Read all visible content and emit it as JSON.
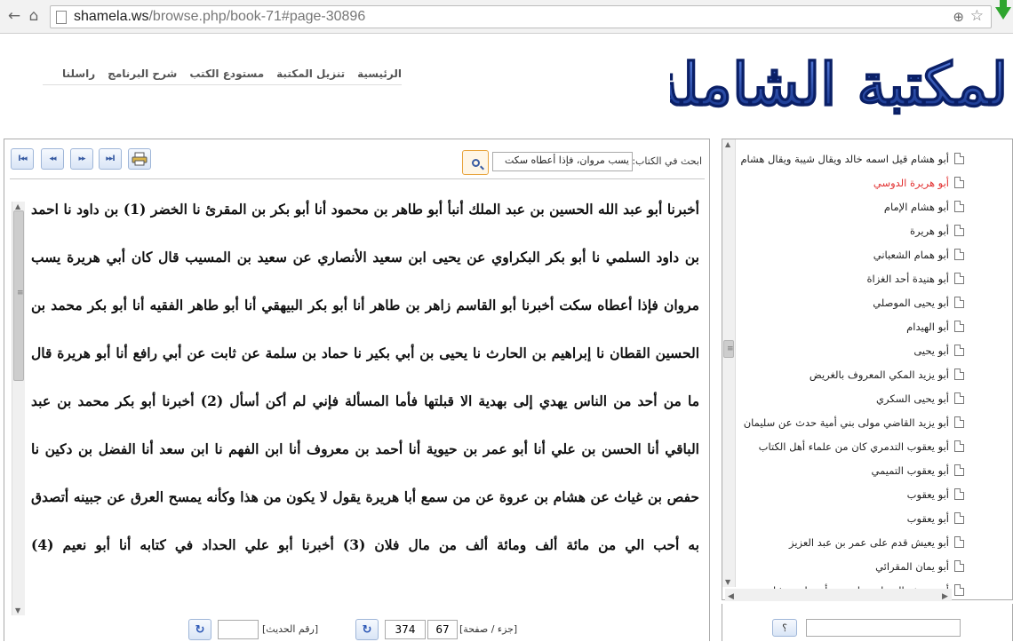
{
  "browser": {
    "url_domain": "shamela.ws",
    "url_path": "/browse.php/book-71#page-30896",
    "back_glyph": "←",
    "home_glyph": "⌂",
    "zoom_glyph": "⊕",
    "star_glyph": "☆",
    "icons": [
      "back-arrow-icon",
      "home-icon",
      "page-icon",
      "zoom-icon",
      "star-icon",
      "download-icon"
    ]
  },
  "nav": {
    "items": [
      "الرئيسية",
      "تنزيل المكتبة",
      "مستودع الكتب",
      "شرح البرنامج",
      "راسلنا"
    ]
  },
  "logo": {
    "text": "المكتبة الشاملة",
    "color": "#1d3f9e"
  },
  "toolbar": {
    "first_glyph": "I◂◂",
    "prev_glyph": "◂◂",
    "next_glyph": "▸▸",
    "last_glyph": "▸▸I",
    "print_icon": "print-icon",
    "search_label": "ابحث في الكتاب:",
    "search_value": "يسب مروان، فإذا أعطاه سكت",
    "search_icon": "search-icon"
  },
  "book": {
    "text": "أخبرنا أبو عبد الله الحسين بن عبد الملك أنبأ أبو طاهر بن محمود أنا أبو بكر بن المقرئ نا الخضر (1) بن داود نا احمد بن داود السلمي نا أبو بكر البكراوي عن يحيى ابن سعيد الأنصاري عن سعيد بن المسيب قال كان أبي هريرة يسب مروان فإذا أعطاه سكت أخبرنا أبو القاسم زاهر بن طاهر أنا أبو بكر البيهقي أنا أبو طاهر الفقيه أنا أبو بكر محمد بن الحسين القطان نا إبراهيم بن الحارث نا يحيى بن أبي بكير نا حماد بن سلمة عن ثابت عن أبي رافع أنا أبو هريرة قال ما من أحد من الناس يهدي إلى بهدية الا قبلتها فأما المسألة فإني لم أكن أسأل (2) أخبرنا أبو بكر محمد بن عبد الباقي أنا الحسن بن علي أنا أبو عمر بن حيوية أنا أحمد بن معروف أنا ابن الفهم نا ابن سعد أنا الفضل بن دكين نا حفص بن غياث عن هشام بن عروة عن من سمع أبا هريرة يقول لا يكون من هذا وكأنه يمسح العرق عن جبينه أتصدق به أحب الي من مائة ألف ومائة ألف من مال فلان (3) أخبرنا أبو علي الحداد في كتابه أنا أبو نعيم (4)"
  },
  "bottom": {
    "page_label": "[جزء / صفحة]",
    "part": "67",
    "page": "374",
    "hadith_label": "[رقم الحديث]",
    "hadith_value": "",
    "go_glyph": "↻",
    "go_icon": "refresh-icon"
  },
  "tree": {
    "items": [
      {
        "label": "أبو هشام قيل اسمه خالد ويقال شيبة ويقال هشام",
        "active": false
      },
      {
        "label": "أبو هريرة الدوسي",
        "active": true
      },
      {
        "label": "أبو هشام الإمام",
        "active": false
      },
      {
        "label": "أبو هريرة",
        "active": false
      },
      {
        "label": "أبو همام الشعباني",
        "active": false
      },
      {
        "label": "أبو هنيدة أحد الغزاة",
        "active": false
      },
      {
        "label": "أبو يحيى الموصلي",
        "active": false
      },
      {
        "label": "أبو الهيدام",
        "active": false
      },
      {
        "label": "أبو يحيى",
        "active": false
      },
      {
        "label": "أبو يزيد المكي المعروف بالغريض",
        "active": false
      },
      {
        "label": "أبو يحيى السكري",
        "active": false
      },
      {
        "label": "أبو يزيد القاضي مولى بني أمية حدث عن سليمان",
        "active": false
      },
      {
        "label": "أبو يعقوب التدمري كان من علماء أهل الكتاب",
        "active": false
      },
      {
        "label": "أبو يعقوب التميمي",
        "active": false
      },
      {
        "label": "أبو يعقوب",
        "active": false
      },
      {
        "label": "أبو يعقوب",
        "active": false
      },
      {
        "label": "أبو يعيش قدم على عمر بن عبد العزيز",
        "active": false
      },
      {
        "label": "أبو يمان المقرائي",
        "active": false
      },
      {
        "label": "أبو يوسف السراج مولى بني أمية ابن هشام بن",
        "active": false
      }
    ],
    "search_value": "",
    "search_btn_label": "؟"
  }
}
